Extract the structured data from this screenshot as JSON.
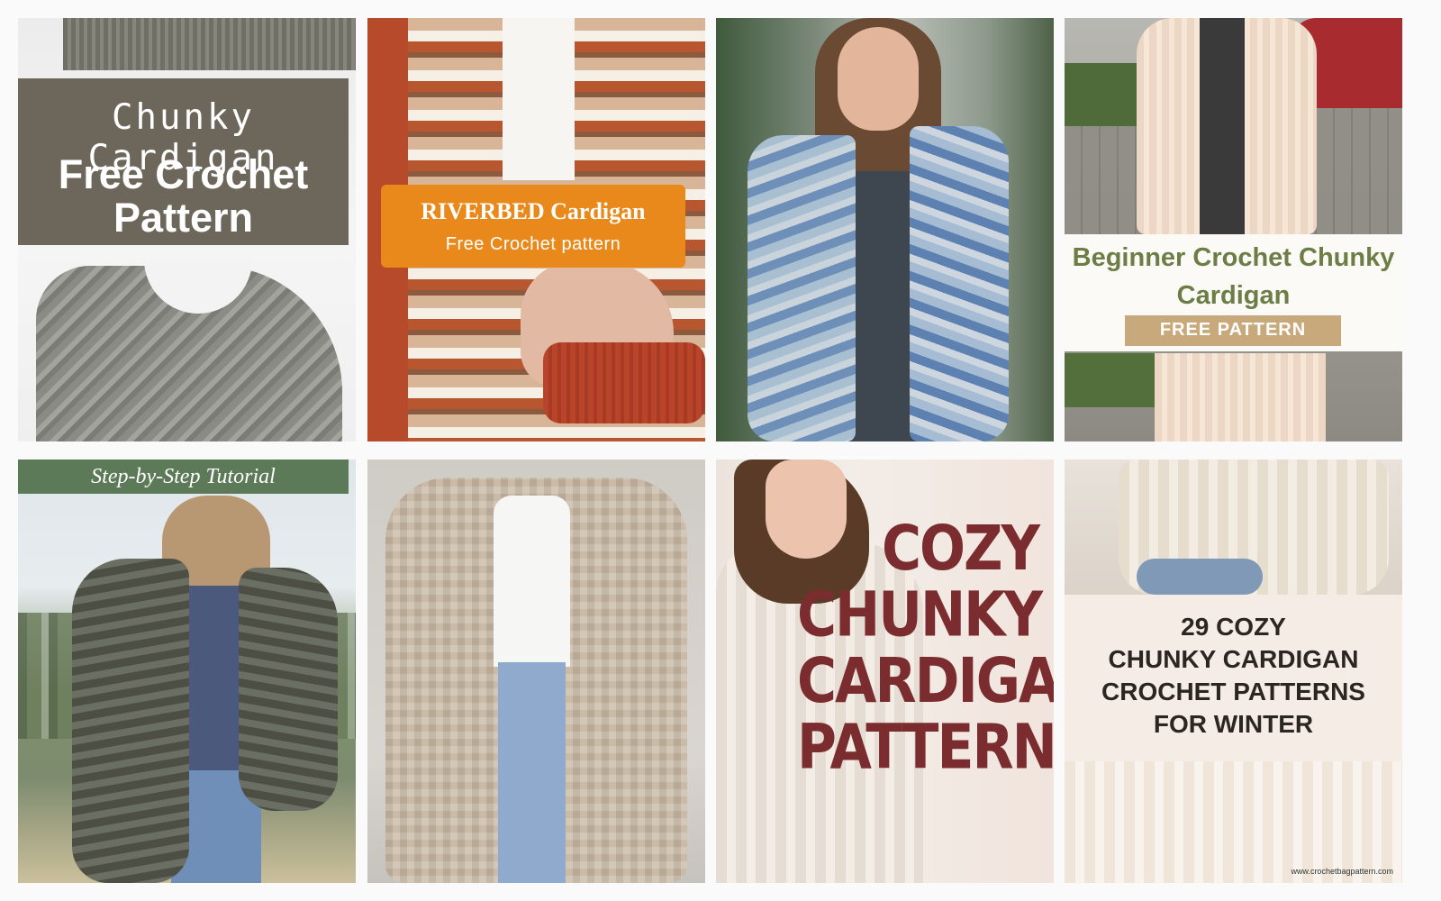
{
  "pins": [
    {
      "id": "chunky-cardigan",
      "lines": [
        "Chunky Cardigan",
        "Free Crochet Pattern"
      ],
      "colors": {
        "band": "#6c675a",
        "text": "#ffffff"
      }
    },
    {
      "id": "riverbed-cardigan",
      "lines": [
        "RIVERBED Cardigan",
        "Free Crochet pattern"
      ],
      "colors": {
        "banner": "#e9891b",
        "text": "#ffffff"
      }
    },
    {
      "id": "blue-cardigan-photo",
      "lines": []
    },
    {
      "id": "beginner-chunky",
      "lines": [
        "Beginner Crochet Chunky Cardigan",
        "FREE PATTERN"
      ],
      "colors": {
        "title": "#6c7d45",
        "badge": "#c8a97c"
      }
    },
    {
      "id": "step-by-step",
      "lines": [
        "Step-by-Step Tutorial"
      ],
      "colors": {
        "band": "#5d7a58"
      }
    },
    {
      "id": "beige-cardigan-photo",
      "lines": []
    },
    {
      "id": "cozy-chunky",
      "lines": [
        "COZY",
        "CHUNKY",
        "CARDIGAN",
        "PATTERNS"
      ],
      "colors": {
        "text": "#7b2c2e"
      }
    },
    {
      "id": "29-cozy",
      "lines": [
        "29 COZY",
        "CHUNKY CARDIGAN",
        "CROCHET PATTERNS",
        "FOR WINTER"
      ],
      "watermark": "www.crochetbagpattern.com",
      "colors": {
        "panel": "#f5ece6",
        "text": "#2b2620"
      }
    }
  ]
}
